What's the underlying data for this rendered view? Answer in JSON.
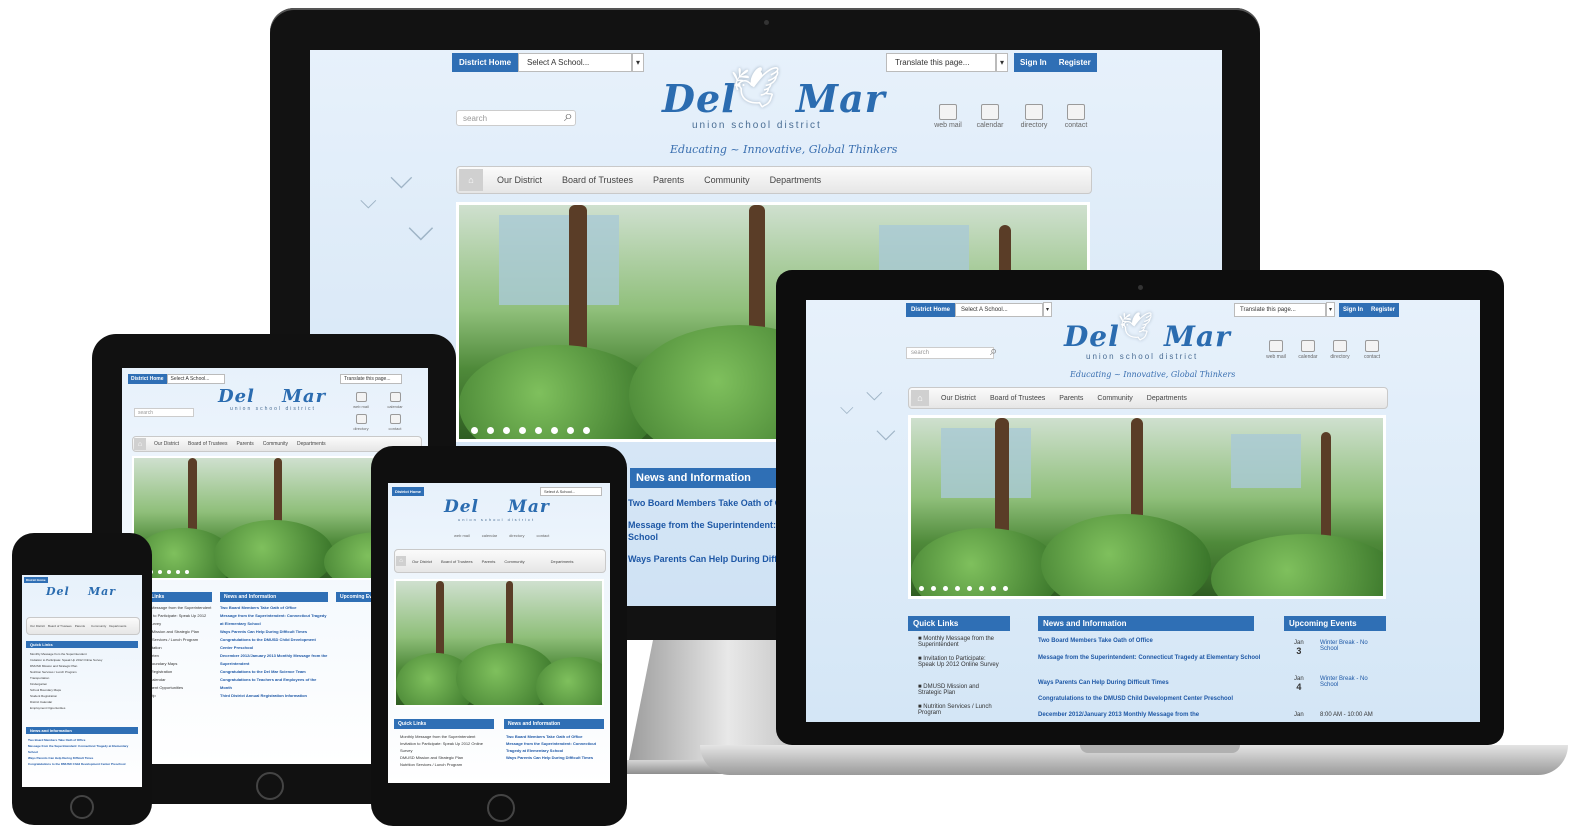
{
  "site": {
    "district_home": "District Home",
    "select_school": "Select A School...",
    "translate": "Translate this page...",
    "sign_in": "Sign In",
    "register": "Register",
    "search_placeholder": "search",
    "logo_left": "Del",
    "logo_right": "Mar",
    "logo_sub": "union school district",
    "tagline": "Educating ~ Innovative, Global Thinkers",
    "icons": [
      {
        "label": "web mail",
        "icon": "webmail-icon"
      },
      {
        "label": "calendar",
        "icon": "calendar-icon"
      },
      {
        "label": "directory",
        "icon": "directory-icon"
      },
      {
        "label": "contact",
        "icon": "phone-icon"
      }
    ],
    "nav": [
      "Our District",
      "Board of Trustees",
      "Parents",
      "Community",
      "Departments"
    ]
  },
  "sections": {
    "quick_links": "Quick Links",
    "news": "News and Information",
    "events": "Upcoming Events"
  },
  "quick_links": [
    "Monthly Message from the Superintendent",
    "Invitation to Participate: Speak Up 2012 Online Survey",
    "DMUSD Mission and Strategic Plan",
    "Nutrition Services / Lunch Program"
  ],
  "news_items": [
    "Two Board Members Take Oath of Office",
    "Message from the Superintendent: Connecticut Tragedy at Elementary School",
    "Ways Parents Can Help During Difficult Times",
    "Congratulations to the DMUSD Child Development Center Preschool",
    "December 2012/January 2013 Monthly Message from the"
  ],
  "events": [
    {
      "month": "Jan",
      "day": "3",
      "text": "Winter Break - No School"
    },
    {
      "month": "Jan",
      "day": "4",
      "text": "Winter Break - No School"
    },
    {
      "month": "Jan",
      "day": "",
      "text": "8:00 AM - 10:00 AM"
    }
  ],
  "monitor_partial_news": [
    "Two Board Members Take Oath of O",
    "Message from the Superintendent: C",
    "School",
    "Ways Parents Can Help During Diffic"
  ],
  "tablet_quick_links": [
    "Monthly Message from the Superintendent",
    "Invitation to Participate: Speak Up 2012 Online Survey",
    "DMUSD Mission and Strategic Plan",
    "Nutrition Services / Lunch Program",
    "Transportation",
    "Kindergarten",
    "School Boundary Maps",
    "Student Registration",
    "District Calendar",
    "Employment Opportunities",
    "Quick Help"
  ],
  "tablet_news": [
    "Two Board Members Take Oath of Office",
    "Message from the Superintendent: Connecticut Tragedy at Elementary School",
    "Ways Parents Can Help During Difficult Times",
    "Congratulations to the DMUSD Child Development Center Preschool",
    "December 2012/January 2013 Monthly Message from the Superintendent",
    "Congratulations to the Del Mar Science Team",
    "Congratulations to Teachers and Employees of the Month",
    "Third District Annual Registration Information"
  ],
  "colors": {
    "accent": "#2f6fb5",
    "link": "#1e58a6",
    "bg": "#e7f1fb"
  }
}
